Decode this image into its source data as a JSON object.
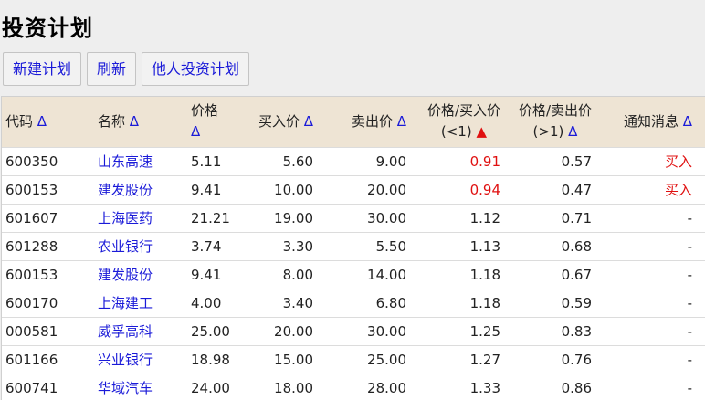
{
  "page": {
    "title": "投资计划"
  },
  "toolbar": {
    "new_plan": "新建计划",
    "refresh": "刷新",
    "others_plan": "他人投资计划"
  },
  "table": {
    "headers": {
      "code": "代码",
      "name": "名称",
      "price": "价格",
      "buy_price": "买入价",
      "sell_price": "卖出价",
      "price_buy_ratio_line1": "价格/买入价",
      "price_buy_ratio_line2": "(<1)",
      "price_sell_ratio_line1": "价格/卖出价",
      "price_sell_ratio_line2": "(>1)",
      "notice": "通知消息"
    },
    "sort_icons": {
      "code": "Δ",
      "name": "Δ",
      "price": "Δ",
      "buy_price": "Δ",
      "sell_price": "Δ",
      "price_buy_ratio": "▲",
      "price_sell_ratio": "Δ",
      "notice": "Δ"
    },
    "rows": [
      {
        "code": "600350",
        "name": "山东高速",
        "price": "5.11",
        "buy": "5.60",
        "sell": "9.00",
        "ratio_buy": "0.91",
        "ratio_sell": "0.57",
        "notice": "买入"
      },
      {
        "code": "600153",
        "name": "建发股份",
        "price": "9.41",
        "buy": "10.00",
        "sell": "20.00",
        "ratio_buy": "0.94",
        "ratio_sell": "0.47",
        "notice": "买入"
      },
      {
        "code": "601607",
        "name": "上海医药",
        "price": "21.21",
        "buy": "19.00",
        "sell": "30.00",
        "ratio_buy": "1.12",
        "ratio_sell": "0.71",
        "notice": "-"
      },
      {
        "code": "601288",
        "name": "农业银行",
        "price": "3.74",
        "buy": "3.30",
        "sell": "5.50",
        "ratio_buy": "1.13",
        "ratio_sell": "0.68",
        "notice": "-"
      },
      {
        "code": "600153",
        "name": "建发股份",
        "price": "9.41",
        "buy": "8.00",
        "sell": "14.00",
        "ratio_buy": "1.18",
        "ratio_sell": "0.67",
        "notice": "-"
      },
      {
        "code": "600170",
        "name": "上海建工",
        "price": "4.00",
        "buy": "3.40",
        "sell": "6.80",
        "ratio_buy": "1.18",
        "ratio_sell": "0.59",
        "notice": "-"
      },
      {
        "code": "000581",
        "name": "威孚高科",
        "price": "25.00",
        "buy": "20.00",
        "sell": "30.00",
        "ratio_buy": "1.25",
        "ratio_sell": "0.83",
        "notice": "-"
      },
      {
        "code": "601166",
        "name": "兴业银行",
        "price": "18.98",
        "buy": "15.00",
        "sell": "25.00",
        "ratio_buy": "1.27",
        "ratio_sell": "0.76",
        "notice": "-"
      },
      {
        "code": "600741",
        "name": "华域汽车",
        "price": "24.00",
        "buy": "18.00",
        "sell": "28.00",
        "ratio_buy": "1.33",
        "ratio_sell": "0.86",
        "notice": "-"
      }
    ]
  },
  "colors": {
    "header_bg": "#eee4d4",
    "link_blue": "#1a1ad8",
    "alert_red": "#e01010",
    "page_bg": "#eeeeee"
  }
}
